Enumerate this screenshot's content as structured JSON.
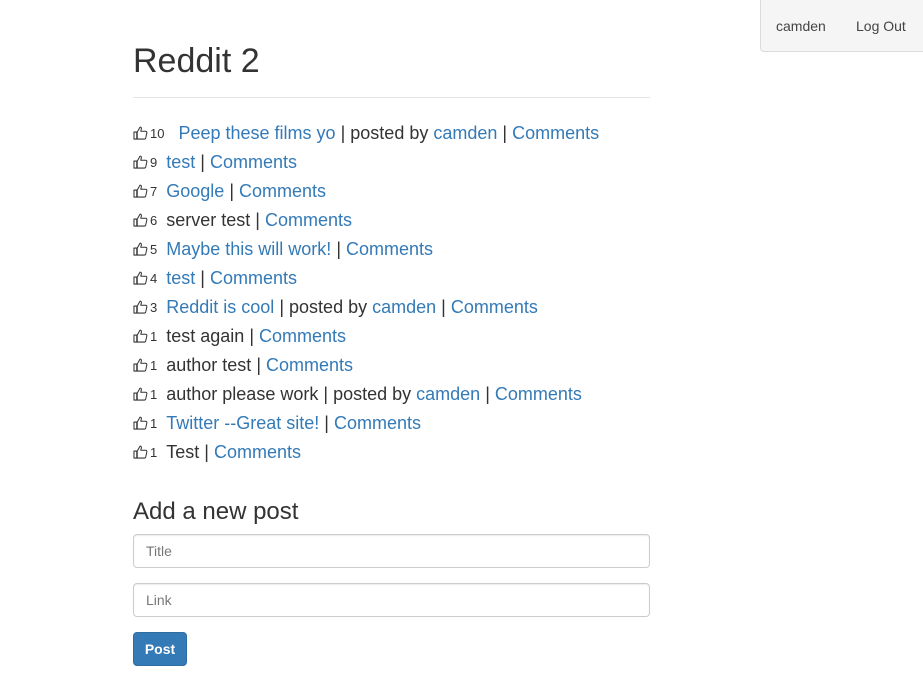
{
  "header": {
    "username": "camden",
    "logout_label": "Log Out"
  },
  "page": {
    "title": "Reddit 2"
  },
  "posts": [
    {
      "votes": "10",
      "title": "Peep these films yo",
      "is_link": true,
      "posted_by": "camden",
      "comments": "Comments"
    },
    {
      "votes": "9",
      "title": "test",
      "is_link": true,
      "posted_by": null,
      "comments": "Comments"
    },
    {
      "votes": "7",
      "title": "Google",
      "is_link": true,
      "posted_by": null,
      "comments": "Comments"
    },
    {
      "votes": "6",
      "title": "server test",
      "is_link": false,
      "posted_by": null,
      "comments": "Comments"
    },
    {
      "votes": "5",
      "title": "Maybe this will work!",
      "is_link": true,
      "posted_by": null,
      "comments": "Comments"
    },
    {
      "votes": "4",
      "title": "test",
      "is_link": true,
      "posted_by": null,
      "comments": "Comments"
    },
    {
      "votes": "3",
      "title": "Reddit is cool",
      "is_link": true,
      "posted_by": "camden",
      "comments": "Comments"
    },
    {
      "votes": "1",
      "title": "test again",
      "is_link": false,
      "posted_by": null,
      "comments": "Comments"
    },
    {
      "votes": "1",
      "title": "author test",
      "is_link": false,
      "posted_by": null,
      "comments": "Comments"
    },
    {
      "votes": "1",
      "title": "author please work",
      "is_link": false,
      "posted_by": "camden",
      "comments": "Comments"
    },
    {
      "votes": "1",
      "title": "Twitter --Great site!",
      "is_link": true,
      "posted_by": null,
      "comments": "Comments"
    },
    {
      "votes": "1",
      "title": "Test",
      "is_link": false,
      "posted_by": null,
      "comments": "Comments"
    }
  ],
  "posted_by_label": "posted by",
  "separator": "|",
  "form": {
    "heading": "Add a new post",
    "title_placeholder": "Title",
    "link_placeholder": "Link",
    "submit_label": "Post"
  },
  "colors": {
    "link": "#337ab7",
    "button": "#337ab7",
    "text": "#333333"
  },
  "icons": {
    "vote": "thumbs-up-icon"
  }
}
